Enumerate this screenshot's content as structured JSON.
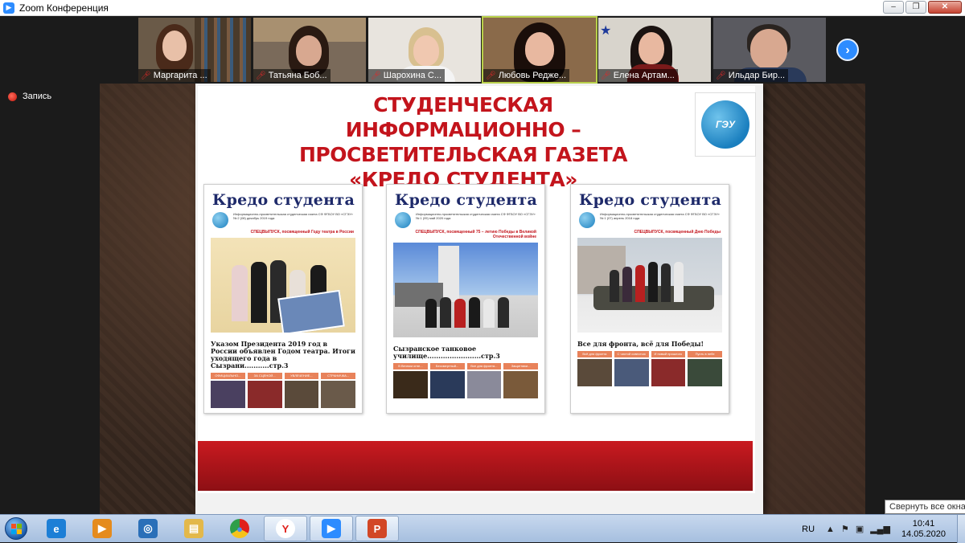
{
  "window": {
    "title": "Zoom Конференция",
    "buttons": {
      "minimize": "–",
      "maximize": "❐",
      "close": "✕"
    }
  },
  "participants": [
    {
      "name": "Маргарита ...",
      "muted": true
    },
    {
      "name": "Татьяна Боб...",
      "muted": true
    },
    {
      "name": "Шарохина С...",
      "muted": true
    },
    {
      "name": "Любовь Редже...",
      "muted": true,
      "active": true
    },
    {
      "name": "Елена Артам...",
      "muted": true
    },
    {
      "name": "Ильдар Бир...",
      "muted": true
    }
  ],
  "gallery_next": "›",
  "recording": {
    "label": "Запись"
  },
  "slide": {
    "title_lines": [
      "СТУДЕНЧЕСКАЯ ИНФОРМАЦИОННО –",
      "ПРОСВЕТИТЕЛЬСКАЯ ГАЗЕТА",
      "«КРЕДО СТУДЕНТА»"
    ],
    "logo_text": "ГЭУ",
    "papers": [
      {
        "masthead": "Кредо студента",
        "meta": "Информационно-просветительская студенческая газета СФ ФГБОУ ВО «СГЭУ» № 2 (08) декабрь 2019 года",
        "special": "СПЕЦВЫПУСК, посвященный Году театра в России",
        "headline": "Указом Президента 2019 год в России объявлен Годом театра. Итоги уходящего года в Сызрани...........стр.3",
        "band": [
          "ОФИЦИАЛЬНО...",
          "ЗА СЦЕНОЙ...",
          "УВЛЕЧЕНИЕ...",
          "СТРАНИЧКА..."
        ]
      },
      {
        "masthead": "Кредо студента",
        "meta": "Информационно-просветительская студенческая газета СФ ФГБОУ ВО «СГЭУ» № 1 (09) май 2020 года",
        "special": "СПЕЦВЫПУСК, посвященный 75 – летию Победы в Великой Отечественной войне",
        "headline": "Сызранское танковое училище........................стр.3",
        "band": [
          "В Вечном огне...",
          "Бессмертный...",
          "Все для фронта...",
          "Защитники..."
        ]
      },
      {
        "masthead": "Кредо студента",
        "meta": "Информационно-просветительская студенческая газета СФ ФГБОУ ВО «СГЭУ» № 1 (07) апрель 2018 года",
        "special": "СПЕЦВЫПУСК, посвященный Дню Победы",
        "headline": "Все для фронта, всё для Победы!",
        "band": [
          "Всё для фронта",
          "С чистой совестью",
          "И новый прошлого",
          "Пусть в небе"
        ]
      }
    ]
  },
  "taskbar": {
    "apps": [
      {
        "name": "internet-explorer",
        "glyph": "e",
        "color": "#1d7fd6"
      },
      {
        "name": "media-player",
        "glyph": "▶",
        "color": "#e58b1d"
      },
      {
        "name": "network-app",
        "glyph": "◎",
        "color": "#2a6fb8"
      },
      {
        "name": "explorer",
        "glyph": "▤",
        "color": "#e3b84a"
      },
      {
        "name": "chrome",
        "glyph": "●",
        "color": "#2e9e4a"
      },
      {
        "name": "yandex",
        "glyph": "Y",
        "color": "#e0201b"
      },
      {
        "name": "zoom",
        "glyph": "▶",
        "color": "#2d8cff"
      },
      {
        "name": "powerpoint",
        "glyph": "P",
        "color": "#d24726"
      }
    ],
    "lang": "RU",
    "time": "10:41",
    "date": "14.05.2020"
  },
  "tooltip": "Свернуть все окна"
}
